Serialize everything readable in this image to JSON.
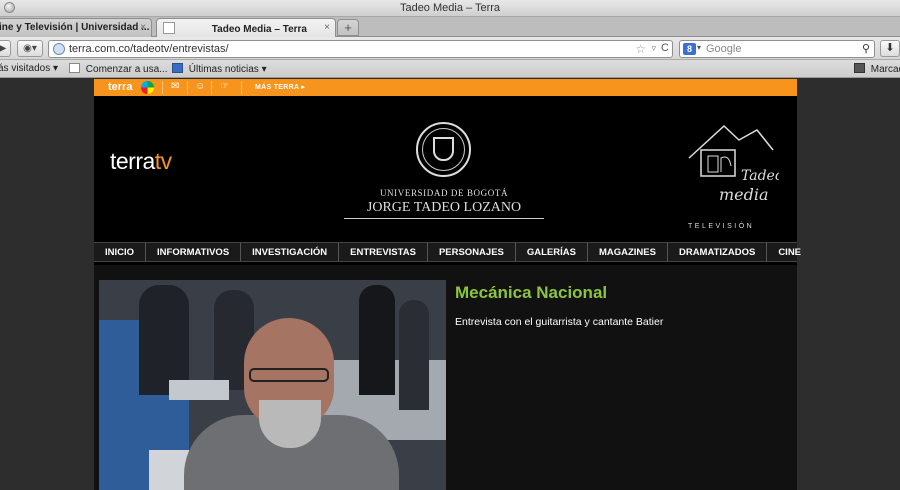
{
  "window": {
    "title": "Tadeo Media – Terra"
  },
  "tabs": [
    {
      "label": "ine y Televisión | Universidad ...",
      "active": false
    },
    {
      "label": "Tadeo Media – Terra",
      "active": true
    }
  ],
  "tab_close_glyph": "×",
  "new_tab_glyph": "+",
  "navbar": {
    "url": "terra.com.co/tadeotv/entrevistas/",
    "search_placeholder": "Google",
    "search_badge": "8",
    "reload_glyph": "C"
  },
  "bookmarks": [
    {
      "label": "ás visitados ▾"
    },
    {
      "label": "Comenzar a usa..."
    },
    {
      "label": "Últimas noticias ▾"
    },
    {
      "label": "Marcad"
    }
  ],
  "site": {
    "orangebar": {
      "brand": "terra",
      "more": "MÁS TERRA ▸"
    },
    "header": {
      "terratv_a": "terra",
      "terratv_b": "tv",
      "university_small": "UNIVERSIDAD DE BOGOTÁ",
      "university_main": "JORGE TADEO LOZANO",
      "tadeo_line1": "Tadeo",
      "tadeo_line2": "media",
      "tadeo_sub": "TELEVISIÓN"
    },
    "menu": [
      "INICIO",
      "INFORMATIVOS",
      "INVESTIGACIÓN",
      "ENTREVISTAS",
      "PERSONAJES",
      "GALERÍAS",
      "MAGAZINES",
      "DRAMATIZADOS",
      "CINE"
    ],
    "feature": {
      "title": "Mecánica Nacional",
      "description": "Entrevista con el guitarrista y cantante Batier"
    }
  },
  "colors": {
    "terra_orange": "#f7941d",
    "title_green": "#8bc53f"
  }
}
